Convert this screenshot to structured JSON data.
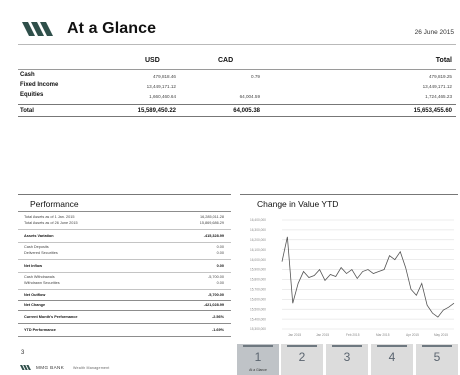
{
  "header": {
    "title": "At a Glance",
    "date": "26 June 2015",
    "logo_icon": "mmg-wave-logo-icon"
  },
  "summary": {
    "columns": [
      "USD",
      "CAD",
      "Total"
    ],
    "rows": [
      {
        "label": "Cash",
        "usd": "479,818.46",
        "cad": "0.79",
        "total": "479,819.25"
      },
      {
        "label": "Fixed Income",
        "usd": "13,449,171.12",
        "cad": "",
        "total": "13,449,171.12"
      },
      {
        "label": "Equities",
        "usd": "1,660,460.64",
        "cad": "64,004.59",
        "total": "1,724,465.23"
      }
    ],
    "total": {
      "label": "Total",
      "usd": "15,589,450.22",
      "cad": "64,005.38",
      "total": "15,653,455.60"
    }
  },
  "performance": {
    "title": "Performance",
    "rows": [
      {
        "label": "Total Assets as of 1 Jan. 2015",
        "value": "16,285,011.28",
        "bold": false
      },
      {
        "label": "Total Assets as of 26 June 2015",
        "value": "15,869,686.29",
        "bold": false
      },
      {
        "label": "Assets Variation",
        "value": "-415,328.99",
        "bold": true
      },
      {
        "label": "Cash Deposits",
        "value": "0.00",
        "bold": false
      },
      {
        "label": "Delivered Securities",
        "value": "0.00",
        "bold": false
      },
      {
        "label": "Net Inflow",
        "value": "0.00",
        "bold": true
      },
      {
        "label": "Cash Withdrawals",
        "value": "-5,700.00",
        "bold": false
      },
      {
        "label": "Withdrawn Securities",
        "value": "0.00",
        "bold": false
      },
      {
        "label": "Net Outflow",
        "value": "-5,700.00",
        "bold": true
      },
      {
        "label": "Net Change",
        "value": "-421,028.99",
        "bold": true
      },
      {
        "label": "Current Month's Performance",
        "value": "-2.56%",
        "bold": true
      },
      {
        "label": "YTD Performance",
        "value": "-1.69%",
        "bold": true
      }
    ]
  },
  "change_chart": {
    "title": "Change in Value YTD",
    "line_color": "#555555",
    "grid_color": "#d9d9d9",
    "y_ticks": [
      "16,400,000",
      "16,300,000",
      "16,200,000",
      "16,100,000",
      "16,000,000",
      "15,900,000",
      "15,800,000",
      "15,700,000",
      "15,600,000",
      "15,500,000",
      "15,400,000",
      "15,300,000"
    ],
    "x_ticks": [
      "Jan 2015",
      "Jan 2015",
      "Feb 2015",
      "Mar 2015",
      "Apr 2015",
      "May 2015"
    ],
    "series": [
      15980000,
      16230000,
      15560000,
      15760000,
      15880000,
      15820000,
      15840000,
      15900000,
      15790000,
      15850000,
      15830000,
      15920000,
      15860000,
      15900000,
      15810000,
      15880000,
      15900000,
      15860000,
      15880000,
      15900000,
      16040000,
      16000000,
      16080000,
      15920000,
      15700000,
      15640000,
      15760000,
      15540000,
      15460000,
      15420000,
      15490000,
      15520000,
      15560000
    ]
  },
  "footer": {
    "page_number": "3",
    "bank_name": "MMG BANK",
    "bank_sub": "Wealth Management",
    "tabs": [
      {
        "num": "1",
        "label": "At a Glance",
        "active": true
      },
      {
        "num": "2",
        "label": "",
        "active": false
      },
      {
        "num": "3",
        "label": "",
        "active": false
      },
      {
        "num": "4",
        "label": "",
        "active": false
      },
      {
        "num": "5",
        "label": "",
        "active": false
      }
    ]
  }
}
